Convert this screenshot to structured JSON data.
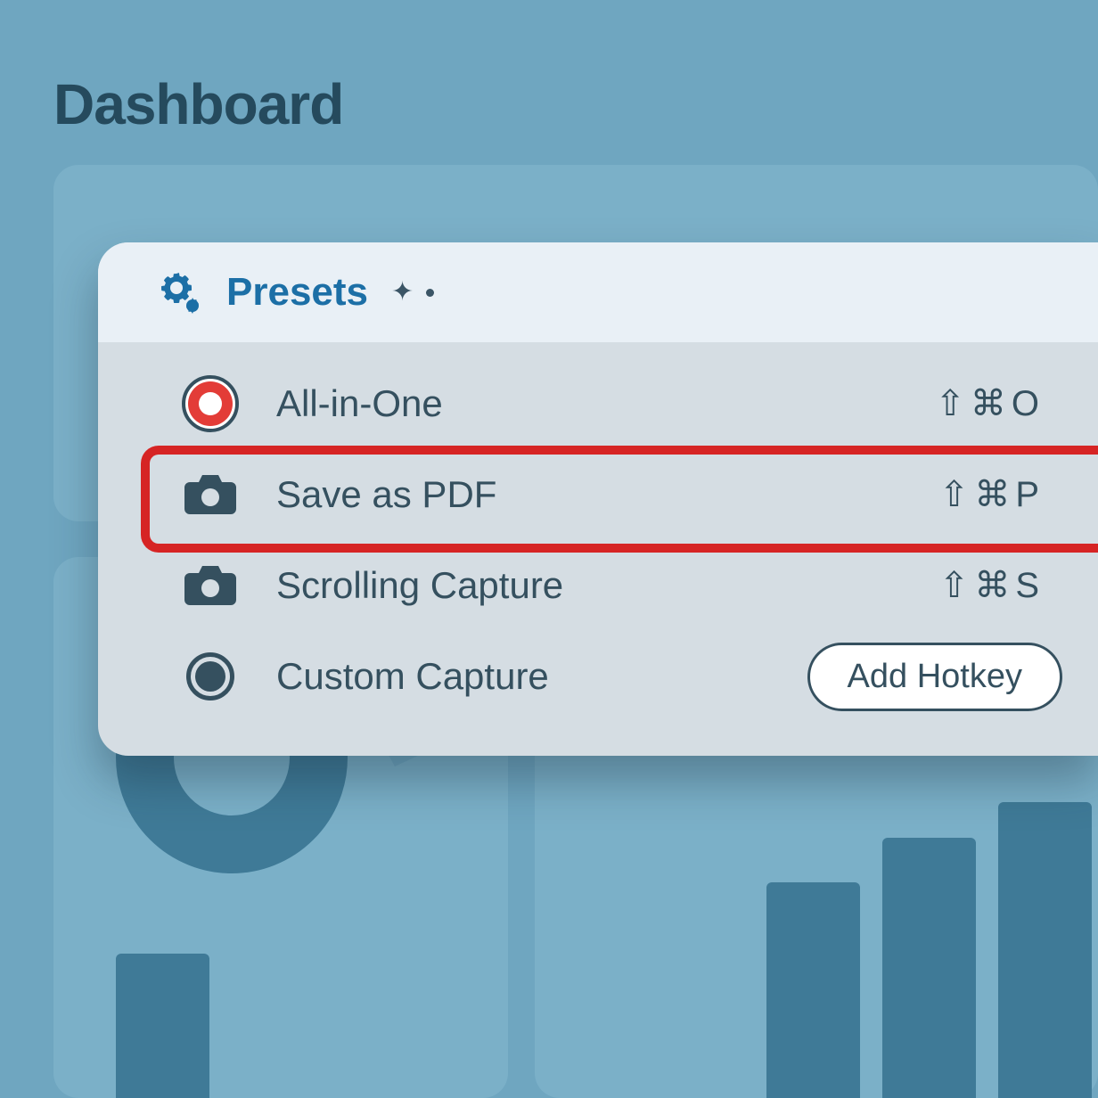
{
  "page": {
    "title": "Dashboard"
  },
  "panel": {
    "header_label": "Presets"
  },
  "presets": [
    {
      "icon": "record",
      "label": "All-in-One",
      "hotkey": "⇧⌘O",
      "action": "hotkey"
    },
    {
      "icon": "camera",
      "label": "Save as PDF",
      "hotkey": "⇧⌘P",
      "action": "hotkey",
      "highlighted": true
    },
    {
      "icon": "camera",
      "label": "Scrolling Capture",
      "hotkey": "⇧⌘S",
      "action": "hotkey"
    },
    {
      "icon": "circle",
      "label": "Custom Capture",
      "hotkey": null,
      "action": "add",
      "add_label": "Add Hotkey"
    }
  ],
  "colors": {
    "bg": "#6fa6c0",
    "card": "#7bb0c8",
    "panel_body": "#d5dde3",
    "panel_header": "#e9f0f6",
    "accent": "#1c6fa6",
    "text_dark": "#254a5d",
    "text": "#35505f",
    "record_red": "#e33c37",
    "highlight": "#d62424"
  }
}
